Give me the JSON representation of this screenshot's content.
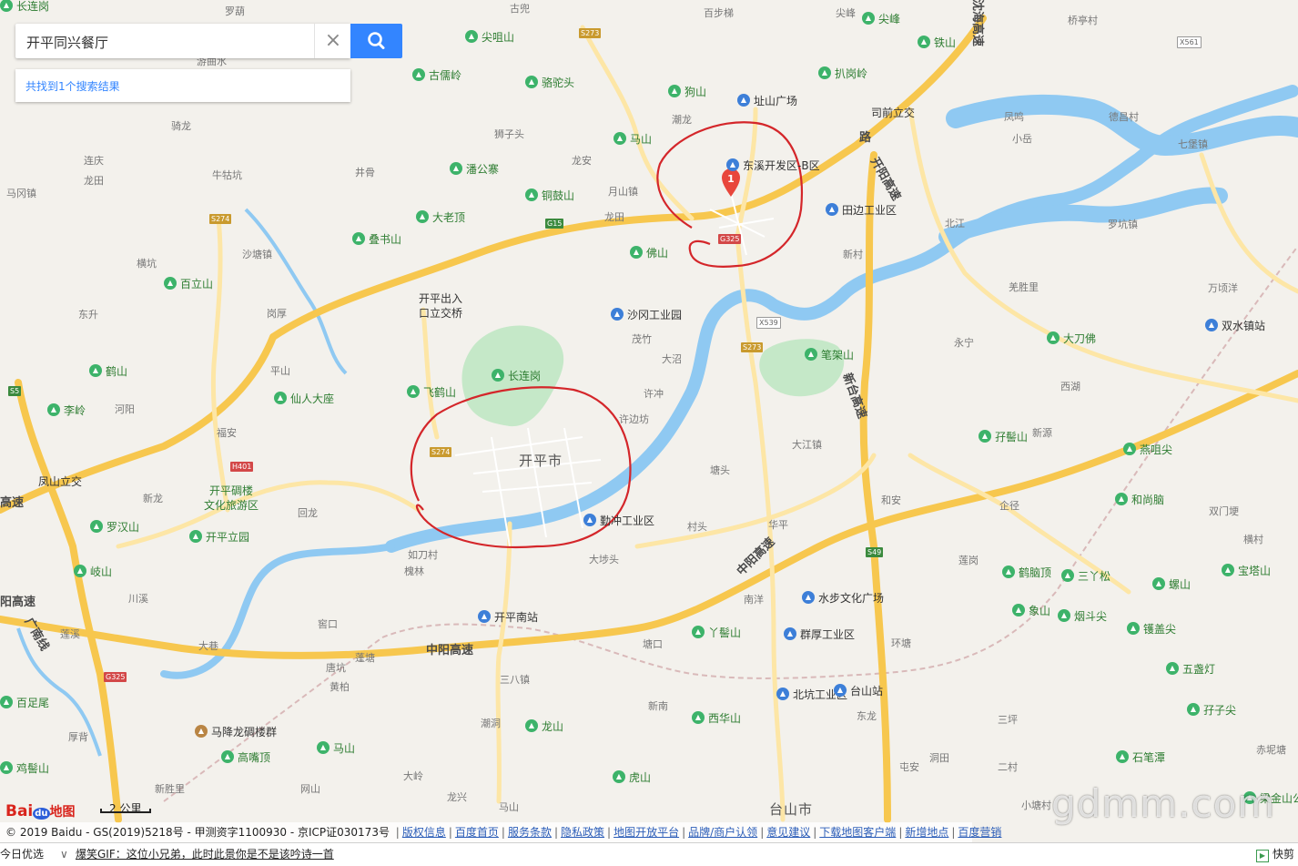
{
  "search": {
    "query": "开平同兴餐厅",
    "clear_label": "×"
  },
  "result": {
    "summary": "共找到1个搜索结果"
  },
  "marker": {
    "index": "1"
  },
  "logo": {
    "part1": "Bai",
    "part2": "du",
    "part3": "地图"
  },
  "scale": {
    "label": "2 公里"
  },
  "map": {
    "city": "开平市",
    "city2": "台山市",
    "highways": [
      "沈海高速",
      "开阳高速",
      "中阳高速",
      "中阳高速",
      "新台高速",
      "广南线",
      "阳高速",
      "高速",
      "路"
    ],
    "towns": [
      "罗葫",
      "古兜",
      "游曲水",
      "骑龙",
      "连庆",
      "龙田",
      "马冈镇",
      "牛牯坑",
      "井骨",
      "狮子头",
      "龙安",
      "月山镇",
      "龙田",
      "百步梯",
      "潮龙",
      "尖峰",
      "桥亭村",
      "凤鸣",
      "小岳",
      "德昌村",
      "七堡镇",
      "北江",
      "罗坑镇",
      "新村",
      "羌胜里",
      "万顷洋",
      "永宁",
      "西湖",
      "新源",
      "茂竹",
      "大沼",
      "许冲",
      "许边坊",
      "大江镇",
      "沙塘镇",
      "横坑",
      "东升",
      "岗厚",
      "平山",
      "河阳",
      "福安",
      "新龙",
      "回龙",
      "如刀村",
      "槐林",
      "大埗头",
      "村头",
      "华平",
      "塘头",
      "和安",
      "企径",
      "双门埂",
      "横村",
      "莲岗",
      "南洋",
      "塘口",
      "环塘",
      "三八镇",
      "新南",
      "东龙",
      "三坪",
      "潮洞",
      "川溪",
      "莲溪",
      "窖口",
      "唐坑",
      "蓬塘",
      "黄柏",
      "大巷",
      "厚背",
      "新胜里",
      "网山",
      "大岭",
      "屯安",
      "洞田",
      "二村",
      "赤坭塘",
      "小塘村",
      "龙兴",
      "马山"
    ],
    "pois_green": [
      "尖咀山",
      "古儒岭",
      "骆驼头",
      "狗山",
      "马山",
      "潘公寨",
      "铜鼓山",
      "大老顶",
      "叠书山",
      "扒岗岭",
      "尖峰",
      "铁山",
      "佛山",
      "百立山",
      "鹤山",
      "仙人大座",
      "飞鹤山",
      "李岭",
      "罗汉山",
      "开平立园",
      "岐山",
      "笔架山",
      "大刀佛",
      "孖髻山",
      "燕咀尖",
      "和尚脑",
      "三丫松",
      "宝塔山",
      "鹤脑顶",
      "螺山",
      "象山",
      "烟斗尖",
      "镬盖尖",
      "五盏灯",
      "孖子尖",
      "石笔潭",
      "丫髻山",
      "西华山",
      "龙山",
      "虎山",
      "马山",
      "高嘴顶",
      "百足尾",
      "鸡髻山",
      "长连岗",
      "梁金山公园",
      "长连岗"
    ],
    "pois_blue": [
      "东溪开发区-B区",
      "田边工业区",
      "沙冈工业园",
      "勤冲工业区",
      "群厚工业区",
      "北坑工业区",
      "水步文化广场",
      "双水镇站",
      "开平南站",
      "台山站",
      "址山广场"
    ],
    "pois_brown": [
      "马降龙碉楼群"
    ],
    "stacked": {
      "kaiping_exit": [
        "开平出入",
        "口立交桥"
      ],
      "diaolou": [
        "开平碉楼",
        "文化旅游区"
      ],
      "fengshan": "凤山立交",
      "sisi": "司前立交"
    },
    "shields": [
      "S273",
      "G15",
      "G325",
      "X539",
      "S273",
      "S274",
      "S274",
      "S5",
      "G325",
      "S49",
      "X561",
      "H401"
    ],
    "colors": {
      "highway": "#f7c74e",
      "road": "#fde6a6",
      "water": "#8fc9f2",
      "park": "#c5e8c8",
      "land": "#f3f1ec",
      "route_circle": "#d4262a"
    }
  },
  "copyright": {
    "text": "© 2019 Baidu - GS(2019)5218号 - 甲测资字1100930 - 京ICP证030173号",
    "links": [
      "版权信息",
      "百度首页",
      "服务条款",
      "隐私政策",
      "地图开放平台",
      "品牌/商户认领",
      "意见建议",
      "下载地图客户端",
      "新增地点",
      "百度营销"
    ]
  },
  "taskbar": {
    "left": "今日优选",
    "news": "爆笑GIF：这位小兄弟，此时此景你是不是该吟诗一首",
    "right": "快剪"
  },
  "watermark": "gdmm.com"
}
